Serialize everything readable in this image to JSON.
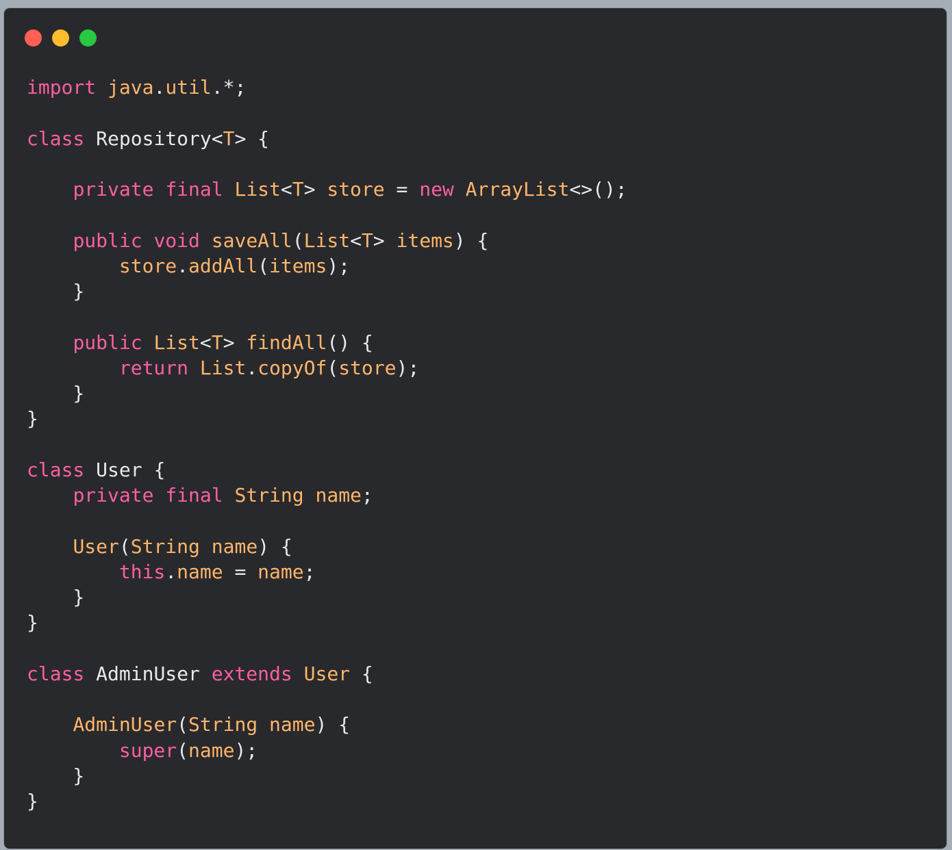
{
  "window": {
    "controls": [
      {
        "name": "close",
        "color": "#ff5f57"
      },
      {
        "name": "minimize",
        "color": "#febc2e"
      },
      {
        "name": "maximize",
        "color": "#28c840"
      }
    ]
  },
  "theme": {
    "keyword": "#fc5fa3",
    "type": "#ffb56b",
    "plain": "#e9e9ea",
    "background": "#28292c"
  },
  "code": {
    "language": "java",
    "lines": [
      [
        [
          "k",
          "import"
        ],
        [
          "p",
          " "
        ],
        [
          "t",
          "java"
        ],
        [
          "p",
          "."
        ],
        [
          "t",
          "util"
        ],
        [
          "p",
          ".*;"
        ]
      ],
      [],
      [
        [
          "k",
          "class"
        ],
        [
          "p",
          " Repository<"
        ],
        [
          "t",
          "T"
        ],
        [
          "p",
          "> {"
        ]
      ],
      [],
      [
        [
          "p",
          "    "
        ],
        [
          "k",
          "private"
        ],
        [
          "p",
          " "
        ],
        [
          "k",
          "final"
        ],
        [
          "p",
          " "
        ],
        [
          "t",
          "List"
        ],
        [
          "p",
          "<"
        ],
        [
          "t",
          "T"
        ],
        [
          "p",
          "> "
        ],
        [
          "t",
          "store"
        ],
        [
          "p",
          " = "
        ],
        [
          "k",
          "new"
        ],
        [
          "p",
          " "
        ],
        [
          "t",
          "ArrayList"
        ],
        [
          "p",
          "<>();"
        ]
      ],
      [],
      [
        [
          "p",
          "    "
        ],
        [
          "k",
          "public"
        ],
        [
          "p",
          " "
        ],
        [
          "k",
          "void"
        ],
        [
          "p",
          " "
        ],
        [
          "t",
          "saveAll"
        ],
        [
          "p",
          "("
        ],
        [
          "t",
          "List"
        ],
        [
          "p",
          "<"
        ],
        [
          "t",
          "T"
        ],
        [
          "p",
          "> "
        ],
        [
          "t",
          "items"
        ],
        [
          "p",
          ") {"
        ]
      ],
      [
        [
          "p",
          "        "
        ],
        [
          "t",
          "store"
        ],
        [
          "p",
          "."
        ],
        [
          "t",
          "addAll"
        ],
        [
          "p",
          "("
        ],
        [
          "t",
          "items"
        ],
        [
          "p",
          ");"
        ]
      ],
      [
        [
          "p",
          "    }"
        ]
      ],
      [],
      [
        [
          "p",
          "    "
        ],
        [
          "k",
          "public"
        ],
        [
          "p",
          " "
        ],
        [
          "t",
          "List"
        ],
        [
          "p",
          "<"
        ],
        [
          "t",
          "T"
        ],
        [
          "p",
          "> "
        ],
        [
          "t",
          "findAll"
        ],
        [
          "p",
          "() {"
        ]
      ],
      [
        [
          "p",
          "        "
        ],
        [
          "k",
          "return"
        ],
        [
          "p",
          " "
        ],
        [
          "t",
          "List"
        ],
        [
          "p",
          "."
        ],
        [
          "t",
          "copyOf"
        ],
        [
          "p",
          "("
        ],
        [
          "t",
          "store"
        ],
        [
          "p",
          ");"
        ]
      ],
      [
        [
          "p",
          "    }"
        ]
      ],
      [
        [
          "p",
          "}"
        ]
      ],
      [],
      [
        [
          "k",
          "class"
        ],
        [
          "p",
          " User {"
        ]
      ],
      [
        [
          "p",
          "    "
        ],
        [
          "k",
          "private"
        ],
        [
          "p",
          " "
        ],
        [
          "k",
          "final"
        ],
        [
          "p",
          " "
        ],
        [
          "t",
          "String"
        ],
        [
          "p",
          " "
        ],
        [
          "t",
          "name"
        ],
        [
          "p",
          ";"
        ]
      ],
      [],
      [
        [
          "p",
          "    "
        ],
        [
          "t",
          "User"
        ],
        [
          "p",
          "("
        ],
        [
          "t",
          "String"
        ],
        [
          "p",
          " "
        ],
        [
          "t",
          "name"
        ],
        [
          "p",
          ") {"
        ]
      ],
      [
        [
          "p",
          "        "
        ],
        [
          "k",
          "this"
        ],
        [
          "p",
          "."
        ],
        [
          "t",
          "name"
        ],
        [
          "p",
          " = "
        ],
        [
          "t",
          "name"
        ],
        [
          "p",
          ";"
        ]
      ],
      [
        [
          "p",
          "    }"
        ]
      ],
      [
        [
          "p",
          "}"
        ]
      ],
      [],
      [
        [
          "k",
          "class"
        ],
        [
          "p",
          " AdminUser "
        ],
        [
          "k",
          "extends"
        ],
        [
          "p",
          " "
        ],
        [
          "t",
          "User"
        ],
        [
          "p",
          " {"
        ]
      ],
      [],
      [
        [
          "p",
          "    "
        ],
        [
          "t",
          "AdminUser"
        ],
        [
          "p",
          "("
        ],
        [
          "t",
          "String"
        ],
        [
          "p",
          " "
        ],
        [
          "t",
          "name"
        ],
        [
          "p",
          ") {"
        ]
      ],
      [
        [
          "p",
          "        "
        ],
        [
          "k",
          "super"
        ],
        [
          "p",
          "("
        ],
        [
          "t",
          "name"
        ],
        [
          "p",
          ");"
        ]
      ],
      [
        [
          "p",
          "    }"
        ]
      ],
      [
        [
          "p",
          "}"
        ]
      ]
    ]
  }
}
